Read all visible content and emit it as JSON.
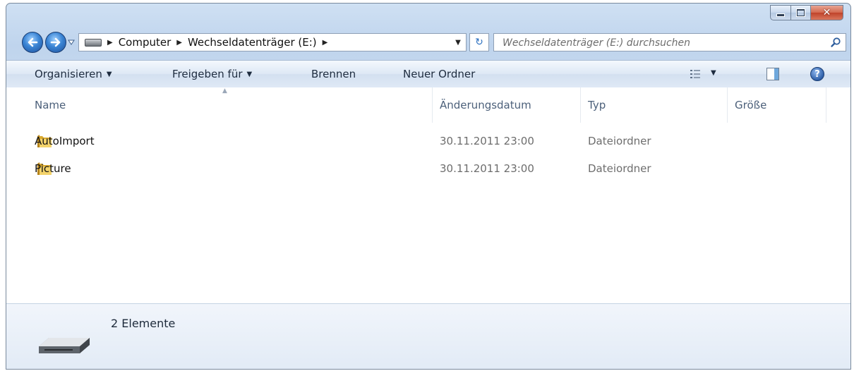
{
  "window": {
    "caption_buttons": {
      "minimize": "minimize-icon",
      "maximize": "maximize-icon",
      "close": "close-icon"
    }
  },
  "navigation": {
    "back_icon": "back-arrow-icon",
    "forward_icon": "forward-arrow-icon",
    "breadcrumbs": [
      "Computer",
      "Wechseldatenträger (E:)"
    ],
    "search_placeholder": "Wechseldatenträger (E:) durchsuchen"
  },
  "toolbar": {
    "organize": "Organisieren",
    "share": "Freigeben für",
    "burn": "Brennen",
    "new_folder": "Neuer Ordner"
  },
  "columns": {
    "name": "Name",
    "date": "Änderungsdatum",
    "type": "Typ",
    "size": "Größe"
  },
  "files": [
    {
      "name": "AutoImport",
      "date": "30.11.2011 23:00",
      "type": "Dateiordner"
    },
    {
      "name": "Picture",
      "date": "30.11.2011 23:00",
      "type": "Dateiordner"
    }
  ],
  "details": {
    "count": "2 Elemente"
  },
  "colors": {
    "accent_blue": "#3a84d4",
    "folder_yellow": "#e8c04a",
    "close_red": "#c0432a"
  }
}
